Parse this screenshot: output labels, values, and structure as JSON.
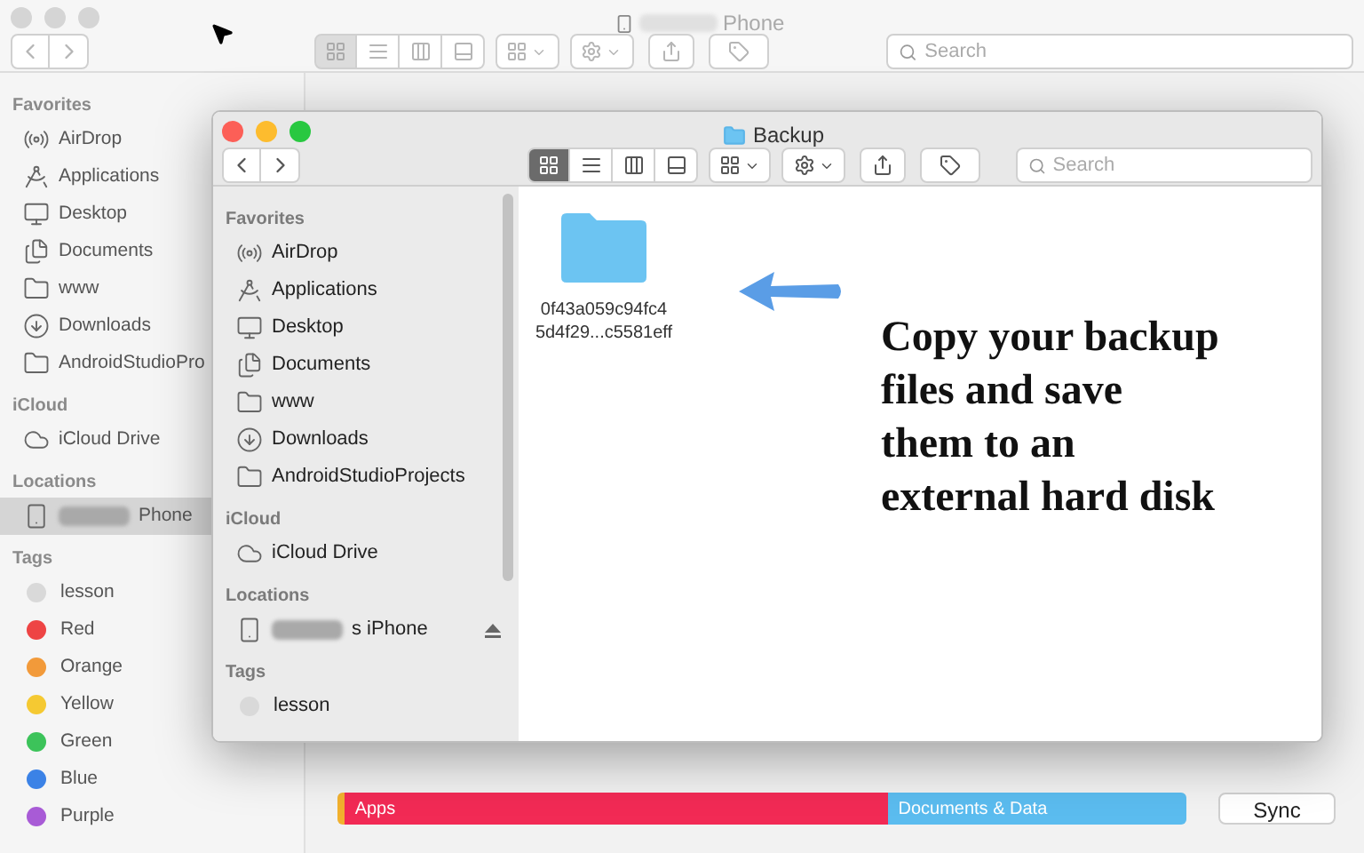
{
  "back_window": {
    "title": "Phone",
    "search": {
      "placeholder": "Search"
    },
    "view_modes": [
      {
        "kind": "icons",
        "selected": true
      },
      {
        "kind": "list",
        "selected": false
      },
      {
        "kind": "columns",
        "selected": false
      },
      {
        "kind": "gallery",
        "selected": false
      }
    ],
    "sidebar": [
      {
        "heading": "Favorites",
        "items": [
          {
            "kind": "airdrop",
            "label": "AirDrop",
            "selected": false
          },
          {
            "kind": "applications",
            "label": "Applications",
            "selected": false
          },
          {
            "kind": "desktop",
            "label": "Desktop",
            "selected": false
          },
          {
            "kind": "documents",
            "label": "Documents",
            "selected": false
          },
          {
            "kind": "folder",
            "label": "www",
            "selected": false
          },
          {
            "kind": "downloads",
            "label": "Downloads",
            "selected": false
          },
          {
            "kind": "folder",
            "label": "AndroidStudioPro",
            "selected": false
          }
        ]
      },
      {
        "heading": "iCloud",
        "items": [
          {
            "kind": "cloud",
            "label": "iCloud Drive",
            "selected": false
          }
        ]
      },
      {
        "heading": "Locations",
        "items": [
          {
            "kind": "device",
            "label": "Phone",
            "blurred": true,
            "selected": true
          }
        ]
      },
      {
        "heading": "Tags",
        "items": [
          {
            "kind": "tag",
            "label": "lesson",
            "color": "#d9d9d9",
            "selected": false
          },
          {
            "kind": "tag",
            "label": "Red",
            "color": "#ee4444",
            "selected": false
          },
          {
            "kind": "tag",
            "label": "Orange",
            "color": "#f29a3a",
            "selected": false
          },
          {
            "kind": "tag",
            "label": "Yellow",
            "color": "#f5c932",
            "selected": false
          },
          {
            "kind": "tag",
            "label": "Green",
            "color": "#3cc35a",
            "selected": false
          },
          {
            "kind": "tag",
            "label": "Blue",
            "color": "#3b82e6",
            "selected": false
          },
          {
            "kind": "tag",
            "label": "Purple",
            "color": "#a85bd6",
            "selected": false
          }
        ]
      }
    ],
    "storage": [
      {
        "color": "#f2b12e",
        "level": 0.008
      },
      {
        "label": "Apps",
        "color": "#f22a55",
        "level": 0.64
      },
      {
        "label": "Documents & Data",
        "color": "#5bbcef",
        "level": 0.352
      }
    ],
    "sync_button": "Sync"
  },
  "front_window": {
    "title": "Backup",
    "search": {
      "placeholder": "Search"
    },
    "view_modes": [
      {
        "kind": "icons",
        "selected": true
      },
      {
        "kind": "list",
        "selected": false
      },
      {
        "kind": "columns",
        "selected": false
      },
      {
        "kind": "gallery",
        "selected": false
      }
    ],
    "sidebar": [
      {
        "heading": "Favorites",
        "items": [
          {
            "kind": "airdrop",
            "label": "AirDrop",
            "selected": false
          },
          {
            "kind": "applications",
            "label": "Applications",
            "selected": false
          },
          {
            "kind": "desktop",
            "label": "Desktop",
            "selected": false
          },
          {
            "kind": "documents",
            "label": "Documents",
            "selected": false
          },
          {
            "kind": "folder",
            "label": "www",
            "selected": false
          },
          {
            "kind": "downloads",
            "label": "Downloads",
            "selected": false
          },
          {
            "kind": "folder",
            "label": "AndroidStudioProjects",
            "selected": false
          }
        ]
      },
      {
        "heading": "iCloud",
        "items": [
          {
            "kind": "cloud",
            "label": "iCloud Drive",
            "selected": false
          }
        ]
      },
      {
        "heading": "Locations",
        "items": [
          {
            "kind": "device",
            "label": "s iPhone",
            "blurred": true,
            "eject": true,
            "selected": false
          }
        ]
      },
      {
        "heading": "Tags",
        "items": [
          {
            "kind": "tag",
            "label": "lesson",
            "color": "#d9d9d9",
            "selected": false
          }
        ]
      }
    ],
    "files": [
      {
        "name_lines": [
          "0f43a059c94fc4",
          "5d4f29...c5581eff"
        ]
      }
    ],
    "annotation": [
      "Copy your backup",
      "files and save",
      "them to an",
      "external hard disk"
    ]
  }
}
